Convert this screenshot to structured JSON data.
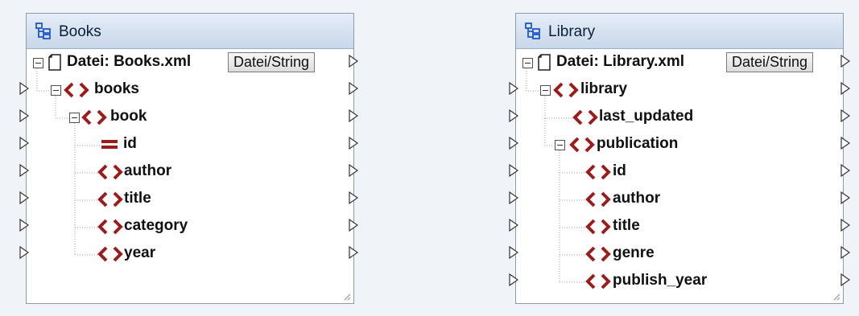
{
  "components": {
    "books": {
      "title": "Books",
      "file_label": "Datei: Books.xml",
      "file_button": "Datei/String",
      "nodes": {
        "root": "books",
        "item": "book",
        "id": "id",
        "author": "author",
        "title": "title",
        "category": "category",
        "year": "year"
      }
    },
    "library": {
      "title": "Library",
      "file_label": "Datei: Library.xml",
      "file_button": "Datei/String",
      "nodes": {
        "root": "library",
        "last_updated": "last_updated",
        "publication": "publication",
        "id": "id",
        "author": "author",
        "title": "title",
        "genre": "genre",
        "publish_year": "publish_year"
      }
    }
  },
  "colors": {
    "element_icon": "#9b1c1c",
    "attribute_icon": "#9b1c1c",
    "header_gradient_top": "#e6eef8",
    "header_gradient_bottom": "#c8d7ea",
    "component_icon": "#1f56c8"
  },
  "icons": {
    "component": "component-icon",
    "file": "file-icon",
    "element": "element-icon",
    "attribute": "attribute-icon",
    "connector": "connector-triangle-icon",
    "collapse": "collapse-toggle-icon"
  }
}
